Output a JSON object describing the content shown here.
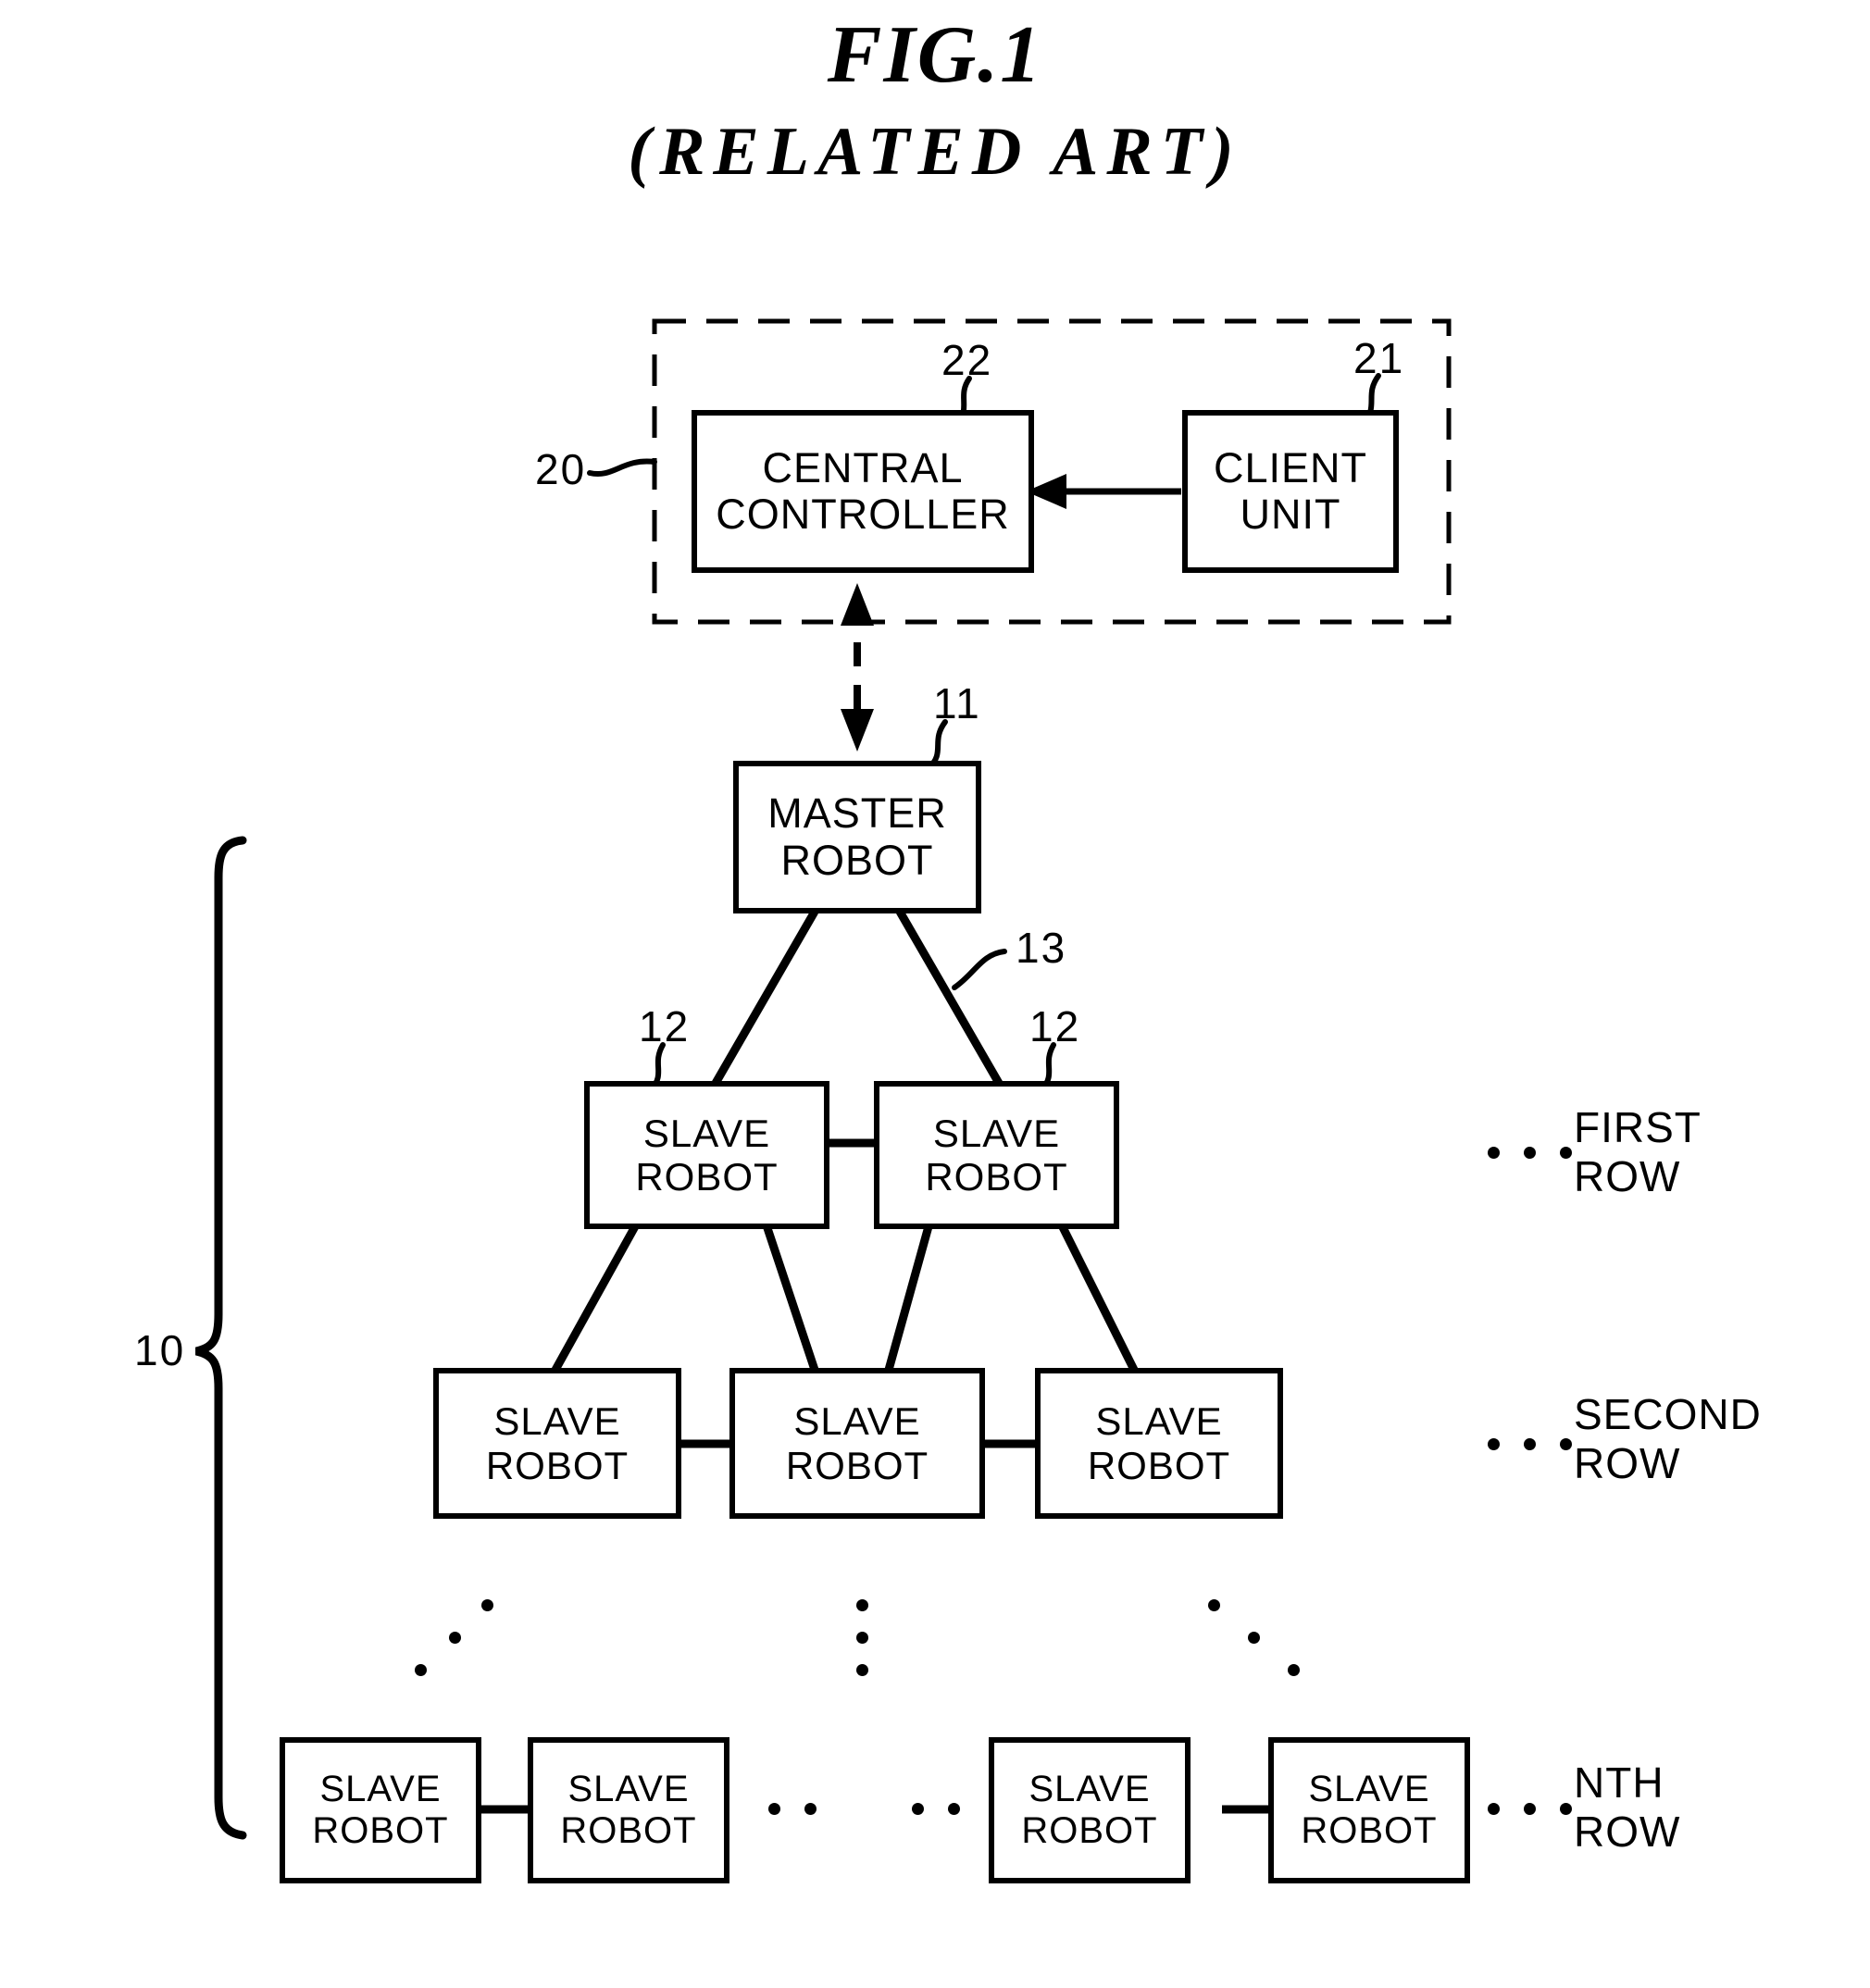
{
  "figure": {
    "title": "FIG.1",
    "subtitle": "(RELATED ART)"
  },
  "diagram_type": "block-diagram",
  "groups": [
    {
      "id": "controller-group",
      "ref": "20",
      "style": "dashed-enclosure",
      "label": "Control station enclosure (dashed)"
    },
    {
      "id": "robot-group",
      "ref": "10",
      "style": "curly-brace",
      "label": "Robot group brace"
    }
  ],
  "nodes": {
    "central_controller": {
      "ref": "22",
      "line1": "CENTRAL",
      "line2": "CONTROLLER"
    },
    "client_unit": {
      "ref": "21",
      "line1": "CLIENT",
      "line2": "UNIT"
    },
    "master_robot": {
      "ref": "11",
      "line1": "MASTER",
      "line2": "ROBOT"
    },
    "slave_robot": {
      "ref": "12",
      "line1": "SLAVE",
      "line2": "ROBOT"
    },
    "link": {
      "ref": "13"
    }
  },
  "rows": {
    "first": {
      "caption_line1": "FIRST",
      "caption_line2": "ROW",
      "slaves": [
        {
          "line1": "SLAVE",
          "line2": "ROBOT",
          "ref": "12"
        },
        {
          "line1": "SLAVE",
          "line2": "ROBOT",
          "ref": "12"
        }
      ]
    },
    "second": {
      "caption_line1": "SECOND",
      "caption_line2": "ROW",
      "slaves": [
        {
          "line1": "SLAVE",
          "line2": "ROBOT"
        },
        {
          "line1": "SLAVE",
          "line2": "ROBOT"
        },
        {
          "line1": "SLAVE",
          "line2": "ROBOT"
        }
      ]
    },
    "nth": {
      "caption_line1": "NTH",
      "caption_line2": "ROW",
      "slaves": [
        {
          "line1": "SLAVE",
          "line2": "ROBOT"
        },
        {
          "line1": "SLAVE",
          "line2": "ROBOT"
        },
        {
          "line1": "SLAVE",
          "line2": "ROBOT"
        },
        {
          "line1": "SLAVE",
          "line2": "ROBOT"
        }
      ]
    }
  },
  "refs": {
    "r10": "10",
    "r11": "11",
    "r12_left": "12",
    "r12_right": "12",
    "r13": "13",
    "r20": "20",
    "r21": "21",
    "r22": "22"
  },
  "colors": {
    "stroke": "#000000",
    "background": "#ffffff"
  }
}
